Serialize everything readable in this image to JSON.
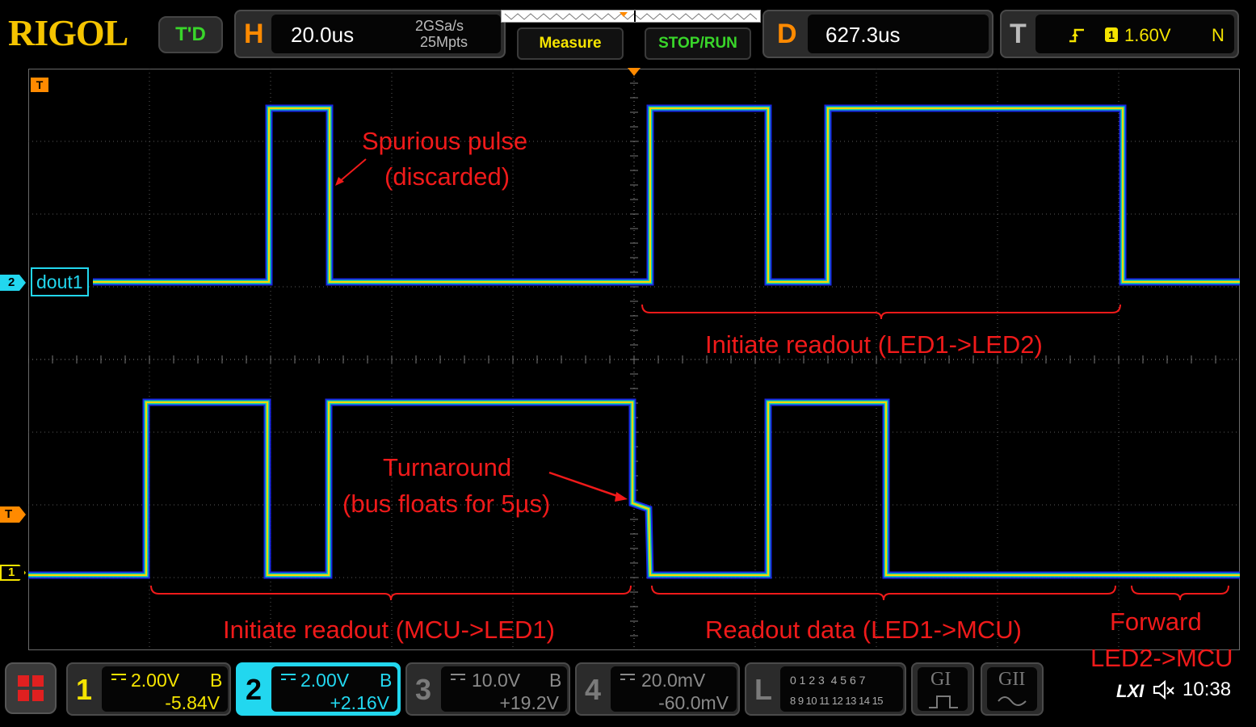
{
  "brand": "RIGOL",
  "mode_button": "T'D",
  "horizontal": {
    "label": "H",
    "timebase": "20.0us",
    "sample_rate": "2GSa/s",
    "memory_depth": "25Mpts"
  },
  "buttons": {
    "measure": "Measure",
    "stop_run": "STOP/RUN"
  },
  "delay": {
    "label": "D",
    "value": "627.3us"
  },
  "trigger": {
    "label": "T",
    "source": "1",
    "level": "1.60V",
    "mode": "N"
  },
  "markers": {
    "trigger_top": "T",
    "trigger_right": "T",
    "ch2_marker": "2",
    "ch1_marker": "1",
    "ch2_label": "dout1"
  },
  "annotations": {
    "spurious_1": "Spurious pulse",
    "spurious_2": "(discarded)",
    "readout_led": "Initiate readout (LED1->LED2)",
    "turnaround_1": "Turnaround",
    "turnaround_2": "(bus floats for 5µs)",
    "readout_mcu": "Initiate readout (MCU->LED1)",
    "readout_data": "Readout data (LED1->MCU)",
    "forward_1": "Forward",
    "forward_2": "LED2->MCU"
  },
  "channels": [
    {
      "num": "1",
      "scale": "2.00V",
      "bw": "B",
      "offset": "-5.84V",
      "color": "#f5e400",
      "active": false
    },
    {
      "num": "2",
      "scale": "2.00V",
      "bw": "B",
      "offset": "+2.16V",
      "color": "#22d7ef",
      "active": true
    },
    {
      "num": "3",
      "scale": "10.0V",
      "bw": "B",
      "offset": "+19.2V",
      "color": "#8a8a8a",
      "active": false
    },
    {
      "num": "4",
      "scale": "20.0mV",
      "bw": "",
      "offset": "-60.0mV",
      "color": "#8a8a8a",
      "active": false
    }
  ],
  "logic": {
    "label": "L",
    "row1": "0 1 2 3  4 5 6 7",
    "row2": "8 9 10 11 12 13 14 15"
  },
  "decoders": {
    "g1": "GI",
    "g2": "GII"
  },
  "status": {
    "lxi": "LXI",
    "time": "10:38"
  },
  "colors": {
    "ch1": "#f5e400",
    "ch2": "#22d7ef",
    "trigger": "#ff8a00",
    "annotation": "#f01a1a"
  }
}
